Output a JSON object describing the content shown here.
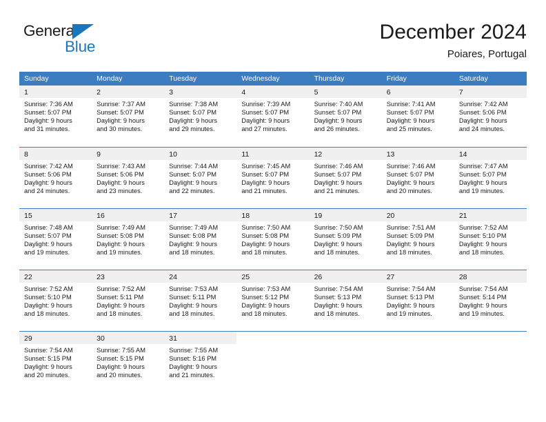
{
  "brand": {
    "name_top": "General",
    "name_bottom": "Blue",
    "accent_color": "#1b76bc"
  },
  "header": {
    "title": "December 2024",
    "subtitle": "Poiares, Portugal"
  },
  "theme": {
    "header_row_bg": "#3b7dc0",
    "daynum_bg": "#f0f0f0",
    "text_color": "#1a1a1a"
  },
  "weekdays": [
    "Sunday",
    "Monday",
    "Tuesday",
    "Wednesday",
    "Thursday",
    "Friday",
    "Saturday"
  ],
  "weeks": [
    [
      {
        "day": "1",
        "sunrise": "Sunrise: 7:36 AM",
        "sunset": "Sunset: 5:07 PM",
        "daylight1": "Daylight: 9 hours",
        "daylight2": "and 31 minutes."
      },
      {
        "day": "2",
        "sunrise": "Sunrise: 7:37 AM",
        "sunset": "Sunset: 5:07 PM",
        "daylight1": "Daylight: 9 hours",
        "daylight2": "and 30 minutes."
      },
      {
        "day": "3",
        "sunrise": "Sunrise: 7:38 AM",
        "sunset": "Sunset: 5:07 PM",
        "daylight1": "Daylight: 9 hours",
        "daylight2": "and 29 minutes."
      },
      {
        "day": "4",
        "sunrise": "Sunrise: 7:39 AM",
        "sunset": "Sunset: 5:07 PM",
        "daylight1": "Daylight: 9 hours",
        "daylight2": "and 27 minutes."
      },
      {
        "day": "5",
        "sunrise": "Sunrise: 7:40 AM",
        "sunset": "Sunset: 5:07 PM",
        "daylight1": "Daylight: 9 hours",
        "daylight2": "and 26 minutes."
      },
      {
        "day": "6",
        "sunrise": "Sunrise: 7:41 AM",
        "sunset": "Sunset: 5:07 PM",
        "daylight1": "Daylight: 9 hours",
        "daylight2": "and 25 minutes."
      },
      {
        "day": "7",
        "sunrise": "Sunrise: 7:42 AM",
        "sunset": "Sunset: 5:06 PM",
        "daylight1": "Daylight: 9 hours",
        "daylight2": "and 24 minutes."
      }
    ],
    [
      {
        "day": "8",
        "sunrise": "Sunrise: 7:42 AM",
        "sunset": "Sunset: 5:06 PM",
        "daylight1": "Daylight: 9 hours",
        "daylight2": "and 24 minutes."
      },
      {
        "day": "9",
        "sunrise": "Sunrise: 7:43 AM",
        "sunset": "Sunset: 5:06 PM",
        "daylight1": "Daylight: 9 hours",
        "daylight2": "and 23 minutes."
      },
      {
        "day": "10",
        "sunrise": "Sunrise: 7:44 AM",
        "sunset": "Sunset: 5:07 PM",
        "daylight1": "Daylight: 9 hours",
        "daylight2": "and 22 minutes."
      },
      {
        "day": "11",
        "sunrise": "Sunrise: 7:45 AM",
        "sunset": "Sunset: 5:07 PM",
        "daylight1": "Daylight: 9 hours",
        "daylight2": "and 21 minutes."
      },
      {
        "day": "12",
        "sunrise": "Sunrise: 7:46 AM",
        "sunset": "Sunset: 5:07 PM",
        "daylight1": "Daylight: 9 hours",
        "daylight2": "and 21 minutes."
      },
      {
        "day": "13",
        "sunrise": "Sunrise: 7:46 AM",
        "sunset": "Sunset: 5:07 PM",
        "daylight1": "Daylight: 9 hours",
        "daylight2": "and 20 minutes."
      },
      {
        "day": "14",
        "sunrise": "Sunrise: 7:47 AM",
        "sunset": "Sunset: 5:07 PM",
        "daylight1": "Daylight: 9 hours",
        "daylight2": "and 19 minutes."
      }
    ],
    [
      {
        "day": "15",
        "sunrise": "Sunrise: 7:48 AM",
        "sunset": "Sunset: 5:07 PM",
        "daylight1": "Daylight: 9 hours",
        "daylight2": "and 19 minutes."
      },
      {
        "day": "16",
        "sunrise": "Sunrise: 7:49 AM",
        "sunset": "Sunset: 5:08 PM",
        "daylight1": "Daylight: 9 hours",
        "daylight2": "and 19 minutes."
      },
      {
        "day": "17",
        "sunrise": "Sunrise: 7:49 AM",
        "sunset": "Sunset: 5:08 PM",
        "daylight1": "Daylight: 9 hours",
        "daylight2": "and 18 minutes."
      },
      {
        "day": "18",
        "sunrise": "Sunrise: 7:50 AM",
        "sunset": "Sunset: 5:08 PM",
        "daylight1": "Daylight: 9 hours",
        "daylight2": "and 18 minutes."
      },
      {
        "day": "19",
        "sunrise": "Sunrise: 7:50 AM",
        "sunset": "Sunset: 5:09 PM",
        "daylight1": "Daylight: 9 hours",
        "daylight2": "and 18 minutes."
      },
      {
        "day": "20",
        "sunrise": "Sunrise: 7:51 AM",
        "sunset": "Sunset: 5:09 PM",
        "daylight1": "Daylight: 9 hours",
        "daylight2": "and 18 minutes."
      },
      {
        "day": "21",
        "sunrise": "Sunrise: 7:52 AM",
        "sunset": "Sunset: 5:10 PM",
        "daylight1": "Daylight: 9 hours",
        "daylight2": "and 18 minutes."
      }
    ],
    [
      {
        "day": "22",
        "sunrise": "Sunrise: 7:52 AM",
        "sunset": "Sunset: 5:10 PM",
        "daylight1": "Daylight: 9 hours",
        "daylight2": "and 18 minutes."
      },
      {
        "day": "23",
        "sunrise": "Sunrise: 7:52 AM",
        "sunset": "Sunset: 5:11 PM",
        "daylight1": "Daylight: 9 hours",
        "daylight2": "and 18 minutes."
      },
      {
        "day": "24",
        "sunrise": "Sunrise: 7:53 AM",
        "sunset": "Sunset: 5:11 PM",
        "daylight1": "Daylight: 9 hours",
        "daylight2": "and 18 minutes."
      },
      {
        "day": "25",
        "sunrise": "Sunrise: 7:53 AM",
        "sunset": "Sunset: 5:12 PM",
        "daylight1": "Daylight: 9 hours",
        "daylight2": "and 18 minutes."
      },
      {
        "day": "26",
        "sunrise": "Sunrise: 7:54 AM",
        "sunset": "Sunset: 5:13 PM",
        "daylight1": "Daylight: 9 hours",
        "daylight2": "and 18 minutes."
      },
      {
        "day": "27",
        "sunrise": "Sunrise: 7:54 AM",
        "sunset": "Sunset: 5:13 PM",
        "daylight1": "Daylight: 9 hours",
        "daylight2": "and 19 minutes."
      },
      {
        "day": "28",
        "sunrise": "Sunrise: 7:54 AM",
        "sunset": "Sunset: 5:14 PM",
        "daylight1": "Daylight: 9 hours",
        "daylight2": "and 19 minutes."
      }
    ],
    [
      {
        "day": "29",
        "sunrise": "Sunrise: 7:54 AM",
        "sunset": "Sunset: 5:15 PM",
        "daylight1": "Daylight: 9 hours",
        "daylight2": "and 20 minutes."
      },
      {
        "day": "30",
        "sunrise": "Sunrise: 7:55 AM",
        "sunset": "Sunset: 5:15 PM",
        "daylight1": "Daylight: 9 hours",
        "daylight2": "and 20 minutes."
      },
      {
        "day": "31",
        "sunrise": "Sunrise: 7:55 AM",
        "sunset": "Sunset: 5:16 PM",
        "daylight1": "Daylight: 9 hours",
        "daylight2": "and 21 minutes."
      },
      {
        "day": "",
        "sunrise": "",
        "sunset": "",
        "daylight1": "",
        "daylight2": ""
      },
      {
        "day": "",
        "sunrise": "",
        "sunset": "",
        "daylight1": "",
        "daylight2": ""
      },
      {
        "day": "",
        "sunrise": "",
        "sunset": "",
        "daylight1": "",
        "daylight2": ""
      },
      {
        "day": "",
        "sunrise": "",
        "sunset": "",
        "daylight1": "",
        "daylight2": ""
      }
    ]
  ]
}
